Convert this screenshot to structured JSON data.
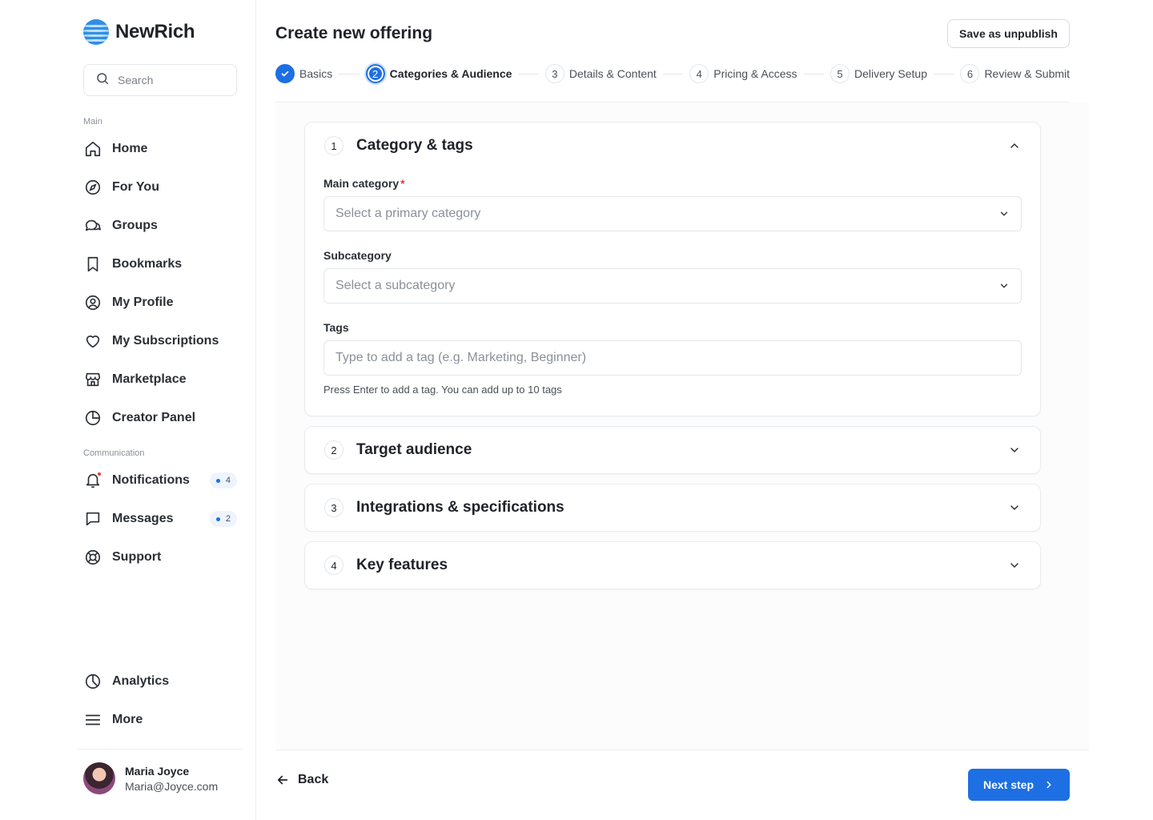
{
  "brand": {
    "name": "NewRich",
    "logo_icon": "globe-waves-icon"
  },
  "search": {
    "placeholder": "Search",
    "icon": "search-icon"
  },
  "sidebar": {
    "main_label": "Main",
    "main_items": [
      {
        "label": "Home",
        "icon": "home-icon"
      },
      {
        "label": "For You",
        "icon": "compass-icon"
      },
      {
        "label": "Groups",
        "icon": "chat-bubbles-icon"
      },
      {
        "label": "Bookmarks",
        "icon": "bookmark-icon"
      },
      {
        "label": "My Profile",
        "icon": "user-circle-icon"
      },
      {
        "label": "My Subscriptions",
        "icon": "heart-icon"
      },
      {
        "label": "Marketplace",
        "icon": "store-icon"
      },
      {
        "label": "Creator Panel",
        "icon": "pie-chart-icon"
      }
    ],
    "communication_label": "Communication",
    "communication_items": [
      {
        "label": "Notifications",
        "icon": "bell-icon",
        "badge": "4"
      },
      {
        "label": "Messages",
        "icon": "message-icon",
        "badge": "2"
      },
      {
        "label": "Support",
        "icon": "lifebuoy-icon"
      }
    ],
    "bottom_items": [
      {
        "label": "Analytics",
        "icon": "chart-pie-icon"
      },
      {
        "label": "More",
        "icon": "menu-icon"
      }
    ],
    "user": {
      "name": "Maria Joyce",
      "email": "Maria@Joyce.com"
    }
  },
  "header": {
    "title": "Create new offering",
    "save_label": "Save as unpublish"
  },
  "steps": [
    {
      "num": "1",
      "label": "Basics",
      "state": "done"
    },
    {
      "num": "2",
      "label": "Categories & Audience",
      "state": "active"
    },
    {
      "num": "3",
      "label": "Details & Content",
      "state": "pending"
    },
    {
      "num": "4",
      "label": "Pricing & Access",
      "state": "pending"
    },
    {
      "num": "5",
      "label": "Delivery Setup",
      "state": "pending"
    },
    {
      "num": "6",
      "label": "Review & Submit",
      "state": "pending"
    }
  ],
  "sections": [
    {
      "num": "1",
      "title": "Category & tags",
      "expanded": true,
      "main_category": {
        "label": "Main category",
        "required": "*",
        "placeholder": "Select a primary category"
      },
      "subcategory": {
        "label": "Subcategory",
        "placeholder": "Select a subcategory"
      },
      "tags": {
        "label": "Tags",
        "placeholder": "Type to add a tag (e.g. Marketing, Beginner)",
        "help": "Press Enter to add a tag. You can add up to 10 tags"
      }
    },
    {
      "num": "2",
      "title": "Target audience",
      "expanded": false
    },
    {
      "num": "3",
      "title": "Integrations & specifications",
      "expanded": false
    },
    {
      "num": "4",
      "title": "Key features",
      "expanded": false
    }
  ],
  "footer": {
    "back_label": "Back",
    "next_label": "Next step"
  },
  "colors": {
    "accent": "#1d6fe3",
    "required": "#e23b3b",
    "border": "#e3e6ea"
  }
}
